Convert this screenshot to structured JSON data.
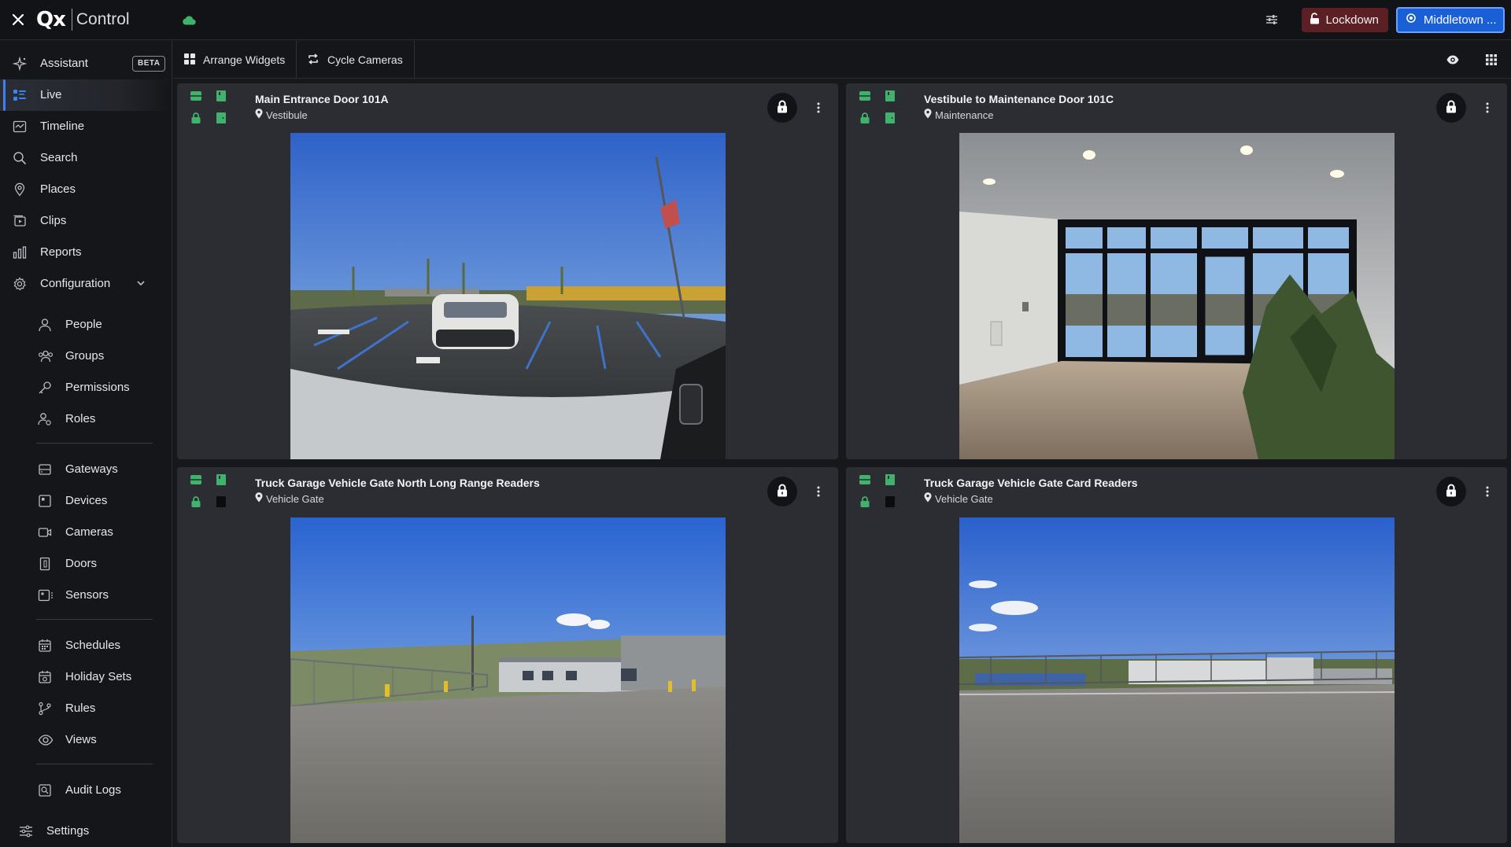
{
  "app": {
    "logo_mark": "Qx",
    "logo_text": "Control",
    "lockdown_label": "Lockdown",
    "site_label": "Middletown ..."
  },
  "sidebar": {
    "assistant": "Assistant",
    "beta": "BETA",
    "live": "Live",
    "timeline": "Timeline",
    "search": "Search",
    "places": "Places",
    "clips": "Clips",
    "reports": "Reports",
    "configuration": "Configuration",
    "people": "People",
    "groups": "Groups",
    "permissions": "Permissions",
    "roles": "Roles",
    "gateways": "Gateways",
    "devices": "Devices",
    "cameras": "Cameras",
    "doors": "Doors",
    "sensors": "Sensors",
    "schedules": "Schedules",
    "holiday_sets": "Holiday Sets",
    "rules": "Rules",
    "views": "Views",
    "audit_logs": "Audit Logs",
    "settings": "Settings"
  },
  "toolbar": {
    "arrange": "Arrange Widgets",
    "cycle": "Cycle Cameras"
  },
  "tiles": [
    {
      "title": "Main Entrance Door 101A",
      "location": "Vestibule"
    },
    {
      "title": "Vestibule to Maintenance Door 101C",
      "location": "Maintenance"
    },
    {
      "title": "Truck Garage Vehicle Gate North Long Range Readers",
      "location": "Vehicle Gate"
    },
    {
      "title": "Truck Garage Vehicle Gate Card Readers",
      "location": "Vehicle Gate"
    }
  ],
  "colors": {
    "accent": "#3b82f6",
    "status_green": "#3fb36b",
    "lockdown": "#5c1f24",
    "site": "#1b5fd6"
  }
}
